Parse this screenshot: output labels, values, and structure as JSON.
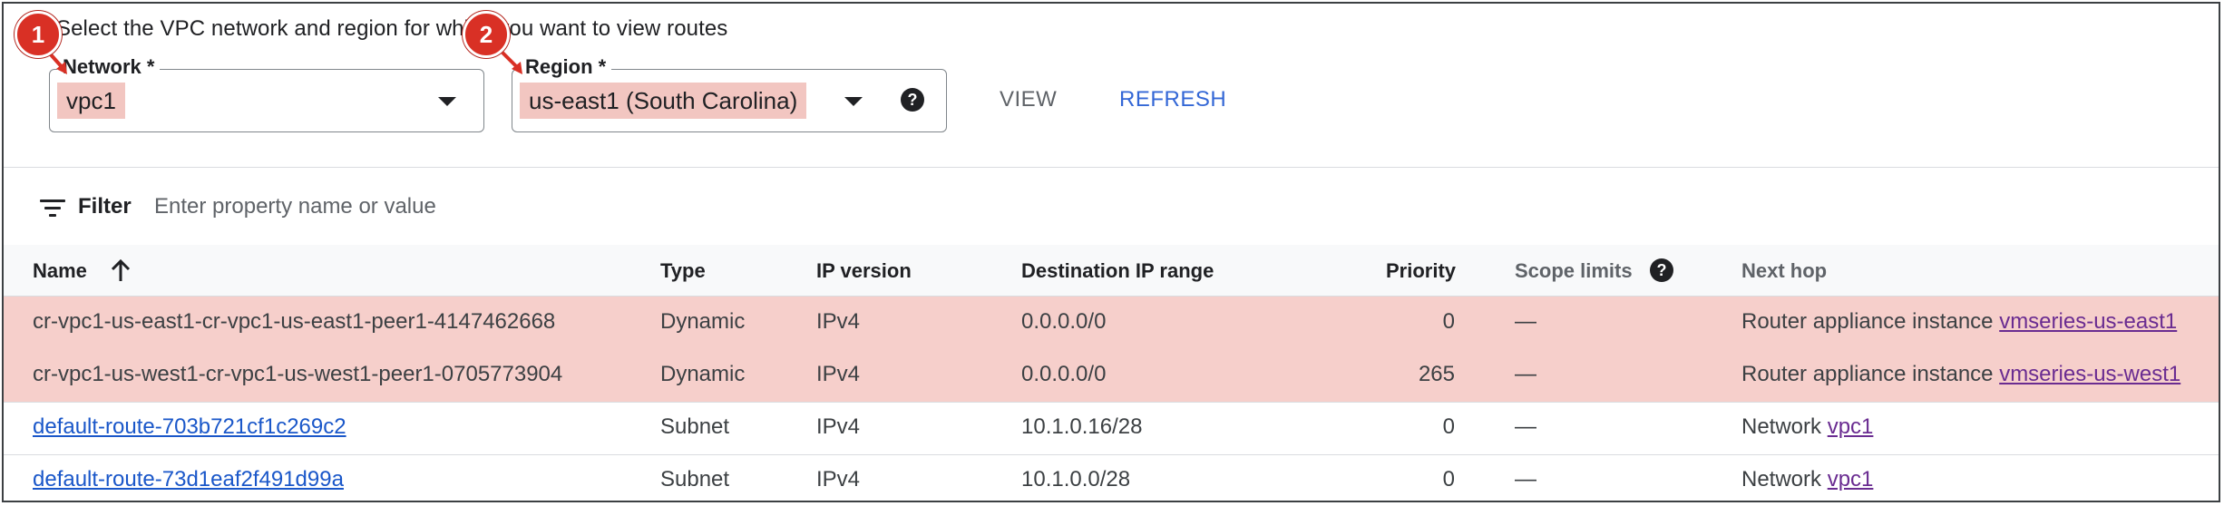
{
  "instruction": "Select the VPC network and region for which you want to view routes",
  "network": {
    "label": "Network *",
    "value": "vpc1"
  },
  "region": {
    "label": "Region *",
    "value": "us-east1 (South Carolina)"
  },
  "buttons": {
    "view": "VIEW",
    "refresh": "REFRESH"
  },
  "filter": {
    "label": "Filter",
    "placeholder": "Enter property name or value"
  },
  "table": {
    "headers": {
      "name": "Name",
      "type": "Type",
      "ip_version": "IP version",
      "dest_range": "Destination IP range",
      "priority": "Priority",
      "scope_limits": "Scope limits",
      "next_hop": "Next hop"
    },
    "rows": [
      {
        "name": "cr-vpc1-us-east1-cr-vpc1-us-east1-peer1-4147462668",
        "type": "Dynamic",
        "ip_version": "IPv4",
        "dest_range": "0.0.0.0/0",
        "priority": "0",
        "scope_limits": "—",
        "next_hop_text": "Router appliance instance",
        "next_hop_link": "vmseries-us-east1",
        "highlighted": true
      },
      {
        "name": "cr-vpc1-us-west1-cr-vpc1-us-west1-peer1-0705773904",
        "type": "Dynamic",
        "ip_version": "IPv4",
        "dest_range": "0.0.0.0/0",
        "priority": "265",
        "scope_limits": "—",
        "next_hop_text": "Router appliance instance",
        "next_hop_link": "vmseries-us-west1",
        "highlighted": true
      },
      {
        "name": "default-route-703b721cf1c269c2",
        "type": "Subnet",
        "ip_version": "IPv4",
        "dest_range": "10.1.0.16/28",
        "priority": "0",
        "scope_limits": "—",
        "next_hop_text": "Network",
        "next_hop_link": "vpc1",
        "highlighted": false
      },
      {
        "name": "default-route-73d1eaf2f491d99a",
        "type": "Subnet",
        "ip_version": "IPv4",
        "dest_range": "10.1.0.0/28",
        "priority": "0",
        "scope_limits": "—",
        "next_hop_text": "Network",
        "next_hop_link": "vpc1",
        "highlighted": false
      }
    ]
  },
  "callouts": {
    "one": "1",
    "two": "2"
  },
  "colors": {
    "callout": "#d93025",
    "highlight": "#f6cfcb",
    "link": "#1a57c9",
    "visited_link": "#6a2c91",
    "accent": "#3367d6"
  }
}
